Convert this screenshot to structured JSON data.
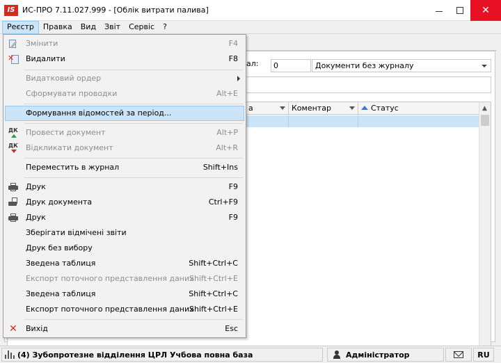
{
  "window": {
    "logo_text": "IS",
    "title": "ИС-ПРО 7.11.027.999 - [Облік витрати палива]"
  },
  "menubar": {
    "items": [
      "Реєстр",
      "Правка",
      "Вид",
      "Звіт",
      "Сервіс",
      "?"
    ]
  },
  "main": {
    "journal_label": "ал:",
    "journal_number": "0",
    "journal_value": "Документи без журналу",
    "columns": [
      {
        "label": "а"
      },
      {
        "label": "Коментар"
      },
      {
        "label": "Статус"
      }
    ]
  },
  "dropdown": {
    "items": [
      {
        "label": "Змінити",
        "shortcut": "F4",
        "disabled": true,
        "icon": "edit-icon"
      },
      {
        "label": "Видалити",
        "shortcut": "F8",
        "disabled": false,
        "icon": "delete-icon"
      },
      {
        "label": "Видатковий ордер",
        "shortcut": "",
        "disabled": true,
        "icon": ""
      },
      {
        "label": "Сформувати проводки",
        "shortcut": "Alt+E",
        "disabled": true,
        "icon": ""
      },
      {
        "label": "Формування відомостей за період...",
        "shortcut": "",
        "disabled": false,
        "icon": ""
      },
      {
        "label": "Провести документ",
        "shortcut": "Alt+P",
        "disabled": true,
        "icon": "post-document-icon"
      },
      {
        "label": "Відкликати документ",
        "shortcut": "Alt+R",
        "disabled": true,
        "icon": "recall-document-icon"
      },
      {
        "label": "Переместить в журнал",
        "shortcut": "Shift+Ins",
        "disabled": false,
        "icon": ""
      },
      {
        "label": "Друк",
        "shortcut": "F9",
        "disabled": false,
        "icon": "printer-icon"
      },
      {
        "label": "Друк документа",
        "shortcut": "Ctrl+F9",
        "disabled": false,
        "icon": "print-document-icon"
      },
      {
        "label": "Друк",
        "shortcut": "F9",
        "disabled": false,
        "icon": "printer-icon"
      },
      {
        "label": "Зберігати відмічені звіти",
        "shortcut": "",
        "disabled": false,
        "icon": ""
      },
      {
        "label": "Друк без вибору",
        "shortcut": "",
        "disabled": false,
        "icon": ""
      },
      {
        "label": "Зведена таблиця",
        "shortcut": "Shift+Ctrl+C",
        "disabled": false,
        "icon": ""
      },
      {
        "label": "Експорт поточного представлення даних",
        "shortcut": "Shift+Ctrl+E",
        "disabled": true,
        "icon": ""
      },
      {
        "label": "Зведена таблиця",
        "shortcut": "Shift+Ctrl+C",
        "disabled": false,
        "icon": ""
      },
      {
        "label": "Експорт поточного представлення даних",
        "shortcut": "Shift+Ctrl+E",
        "disabled": false,
        "icon": ""
      },
      {
        "label": "Вихід",
        "shortcut": "Esc",
        "disabled": false,
        "icon": "exit-icon"
      }
    ],
    "dk_text": "ДК"
  },
  "statusbar": {
    "organization": "(4) Зубопротезне відділення ЦРЛ Учбова повна база",
    "user": "Адміністратор",
    "language": "RU"
  },
  "colors": {
    "highlight": "#cce4f7",
    "close_button": "#e81123",
    "logo": "#d42a1f"
  }
}
